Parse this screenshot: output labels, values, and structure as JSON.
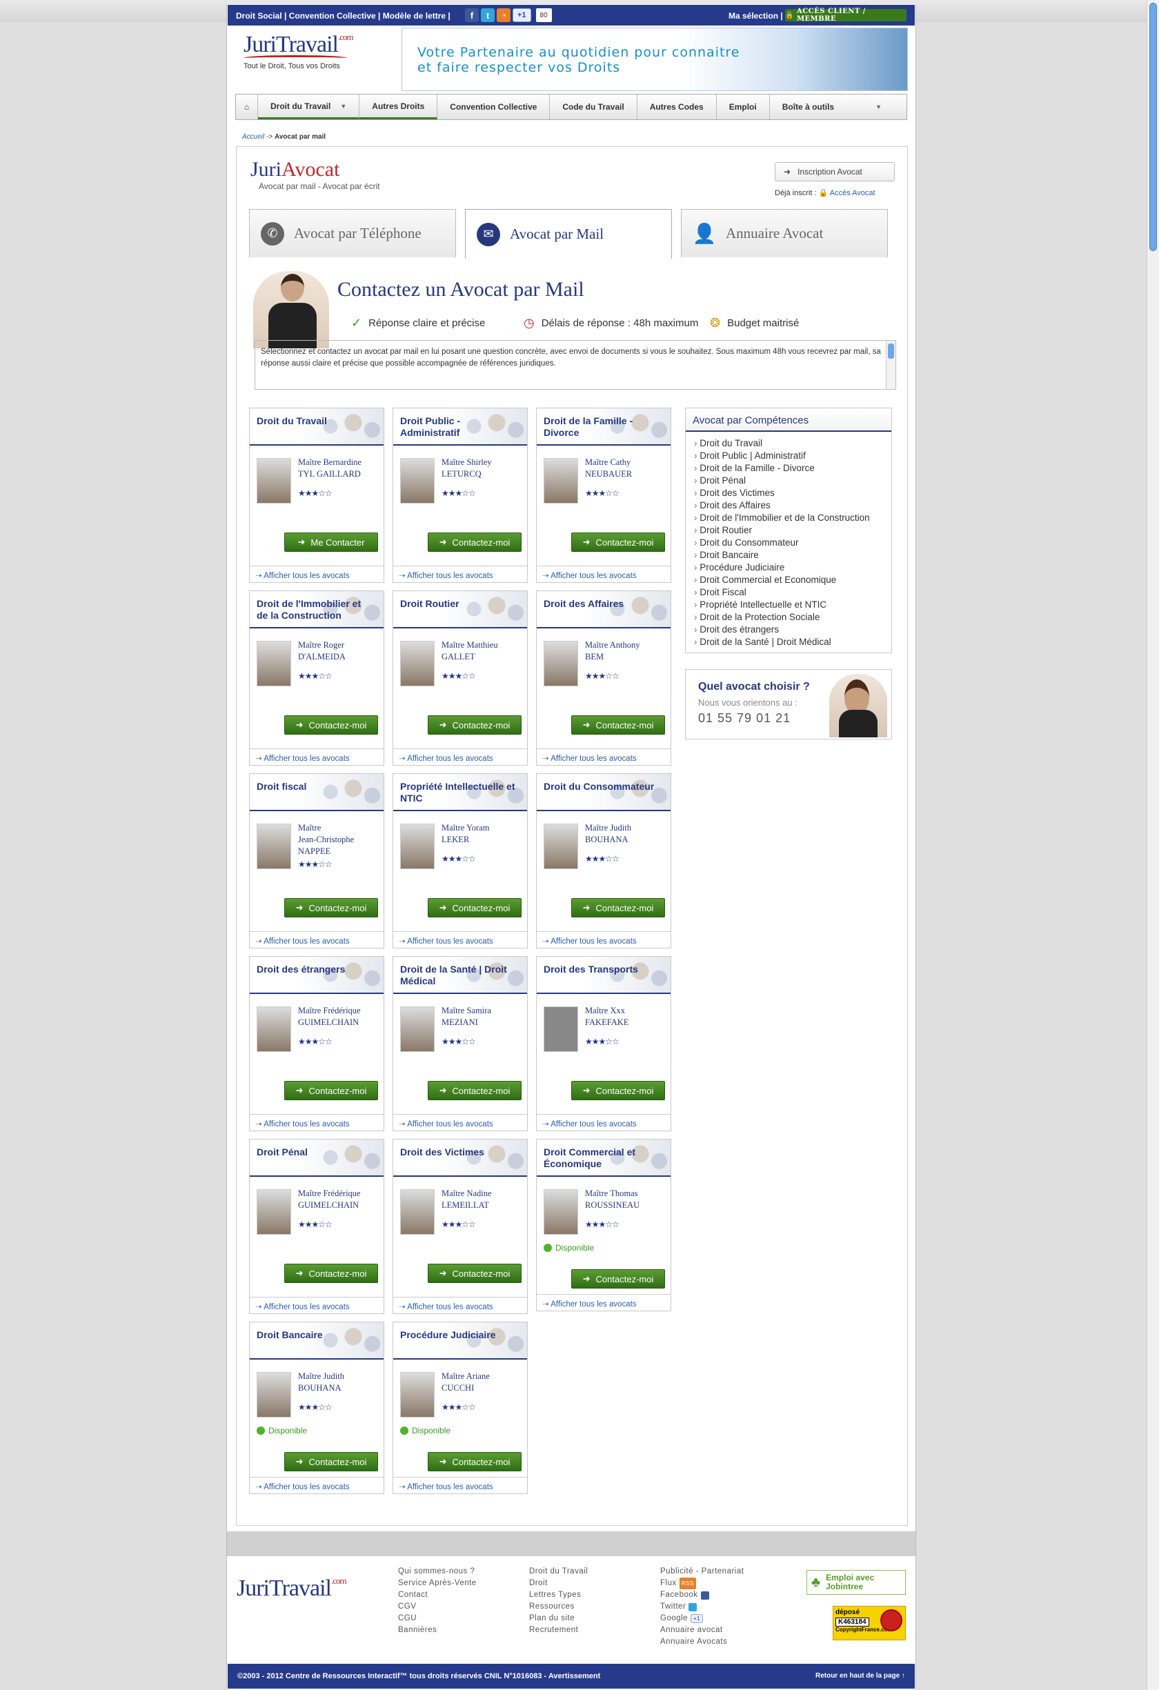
{
  "topbar": {
    "links": "Droit Social  |  Convention Collective  |  Modèle de lettre  |",
    "plusone": "+1",
    "count": "80",
    "ma_selection": "Ma sélection  |",
    "acces_client": "ACCÈS CLIENT / MEMBRE"
  },
  "logo": {
    "juri": "Juri",
    "travail": "Travail",
    "com": ".com",
    "tagline": "Tout le Droit, Tous vos Droits"
  },
  "banner": {
    "text": "Votre Partenaire au quotidien pour connaitre\net faire respecter vos Droits"
  },
  "nav": [
    "Droit du Travail",
    "Autres Droits",
    "Convention Collective",
    "Code du Travail",
    "Autres Codes",
    "Emploi",
    "Boîte à outils"
  ],
  "breadcrumb": {
    "home": "Accueil",
    "sep": " -> ",
    "current": "Avocat par mail"
  },
  "juriavocat": {
    "juri": "Juri",
    "avocat": "Avocat",
    "subtitle": "Avocat par mail - Avocat par écrit",
    "inscription": "Inscription Avocat",
    "deja": "Déjà inscrit : ",
    "acces": "Accès Avocat"
  },
  "tabs": [
    "Avocat par Téléphone",
    "Avocat par Mail",
    "Annuaire Avocat"
  ],
  "contact": {
    "title": "Contactez un Avocat par Mail",
    "f1": "Réponse claire et précise",
    "f2": "Délais de réponse : 48h maximum",
    "f3": "Budget maitrisé",
    "desc": "Sélectionnez et contactez un avocat par mail en lui posant une question concrète, avec envoi de documents si vous le souhaitez. Sous maximum 48h vous recevrez par mail, sa réponse aussi claire et précise que possible accompagnée de références juridiques."
  },
  "cards": [
    {
      "title": "Droit du Travail",
      "l1": "Maître Bernardine",
      "l2": "TYL GAILLARD",
      "l3": "",
      "stars": "★★★☆☆",
      "dispo": "",
      "btn": "Me Contacter"
    },
    {
      "title": "Droit Public - Administratif",
      "l1": "Maître Shirley",
      "l2": "LETURCQ",
      "l3": "",
      "stars": "★★★☆☆",
      "dispo": "",
      "btn": "Contactez-moi"
    },
    {
      "title": "Droit de la Famille - Divorce",
      "l1": "Maître Cathy",
      "l2": "NEUBAUER",
      "l3": "",
      "stars": "★★★☆☆",
      "dispo": "",
      "btn": "Contactez-moi"
    },
    {
      "title": "Droit de l'Immobilier et de la Construction",
      "l1": "Maître Roger",
      "l2": "D'ALMEIDA",
      "l3": "",
      "stars": "★★★☆☆",
      "dispo": "",
      "btn": "Contactez-moi"
    },
    {
      "title": "Droit Routier",
      "l1": "Maître Matthieu",
      "l2": "GALLET",
      "l3": "",
      "stars": "★★★☆☆",
      "dispo": "",
      "btn": "Contactez-moi"
    },
    {
      "title": "Droit des Affaires",
      "l1": "Maître Anthony",
      "l2": "BEM",
      "l3": "",
      "stars": "★★★☆☆",
      "dispo": "",
      "btn": "Contactez-moi"
    },
    {
      "title": "Droit fiscal",
      "l1": "Maître",
      "l2": "Jean-Christophe",
      "l3": "NAPPEE",
      "stars": "★★★☆☆",
      "dispo": "",
      "btn": "Contactez-moi"
    },
    {
      "title": "Propriété Intellectuelle et NTIC",
      "l1": "Maître Yoram",
      "l2": "LEKER",
      "l3": "",
      "stars": "★★★☆☆",
      "dispo": "",
      "btn": "Contactez-moi"
    },
    {
      "title": "Droit du Consommateur",
      "l1": "Maître Judith",
      "l2": "BOUHANA",
      "l3": "",
      "stars": "★★★☆☆",
      "dispo": "",
      "btn": "Contactez-moi"
    },
    {
      "title": "Droit des étrangers",
      "l1": "Maître Frédérique",
      "l2": "GUIMELCHAIN",
      "l3": "",
      "stars": "★★★☆☆",
      "dispo": "",
      "btn": "Contactez-moi"
    },
    {
      "title": "Droit de la Santé | Droit Médical",
      "l1": "Maître Samira",
      "l2": "MEZIANI",
      "l3": "",
      "stars": "★★★☆☆",
      "dispo": "",
      "btn": "Contactez-moi"
    },
    {
      "title": "Droit des Transports",
      "l1": "Maître Xxx",
      "l2": "FAKEFAKE",
      "l3": "",
      "stars": "★★★☆☆",
      "dispo": "",
      "btn": "Contactez-moi"
    },
    {
      "title": "Droit Pénal",
      "l1": "Maître Frédérique",
      "l2": "GUIMELCHAIN",
      "l3": "",
      "stars": "★★★☆☆",
      "dispo": "",
      "btn": "Contactez-moi"
    },
    {
      "title": "Droit des Victimes",
      "l1": "Maître Nadine",
      "l2": "LEMEILLAT",
      "l3": "",
      "stars": "★★★☆☆",
      "dispo": "",
      "btn": "Contactez-moi"
    },
    {
      "title": "Droit Commercial et Économique",
      "l1": "Maître Thomas",
      "l2": "ROUSSINEAU",
      "l3": "",
      "stars": "★★★☆☆",
      "dispo": "Disponible",
      "btn": "Contactez-moi"
    },
    {
      "title": "Droit Bancaire",
      "l1": "Maître Judith",
      "l2": "BOUHANA",
      "l3": "",
      "stars": "★★★☆☆",
      "dispo": "Disponible",
      "btn": "Contactez-moi"
    },
    {
      "title": "Procédure Judiciaire",
      "l1": "Maître Ariane",
      "l2": "CUCCHI",
      "l3": "",
      "stars": "★★★☆☆",
      "dispo": "Disponible",
      "btn": "Contactez-moi"
    }
  ],
  "all_link": "Afficher tous les avocats",
  "competences": {
    "title": "Avocat par Compétences",
    "items": [
      "Droit du Travail",
      "Droit Public | Administratif",
      "Droit de la Famille - Divorce",
      "Droit Pénal",
      "Droit des Victimes",
      "Droit des Affaires",
      "Droit de l'Immobilier et de la Construction",
      "Droit Routier",
      "Droit du Consommateur",
      "Droit Bancaire",
      "Procédure Judiciaire",
      "Droit Commercial et Economique",
      "Droit Fiscal",
      "Propriété Intellectuelle et NTIC",
      "Droit de la Protection Sociale",
      "Droit des étrangers",
      "Droit de la Santé | Droit Médical"
    ]
  },
  "quel": {
    "q1": "Quel avocat choisir ?",
    "q2": "Nous vous orientons au :",
    "phone": "01 55 79 01 21"
  },
  "footer": {
    "col1": [
      "Qui sommes-nous ?",
      "Service Après-Vente",
      "Contact",
      "CGV",
      "CGU",
      "Bannières"
    ],
    "col2": [
      "Droit du Travail",
      "Droit",
      "Lettres Types",
      "Ressources",
      "Plan du site",
      "Recrutement"
    ],
    "col3": [
      "Publicité - Partenariat",
      "Flux",
      "Facebook",
      "Twitter",
      "Google",
      "Annuaire avocat",
      "Annuaire Avocats"
    ],
    "rss": "RSS",
    "gplus": "+1",
    "jobin": "Emploi avec Jobintree",
    "depose": "déposé",
    "code": "K463184",
    "copyright_france": "CopyrightFrance.com",
    "copyright": "©2003 - 2012 Centre de Ressources Interactif™ tous droits réservés CNIL N°1016083 - Avertissement",
    "top": "Retour en haut de la page ↑"
  }
}
